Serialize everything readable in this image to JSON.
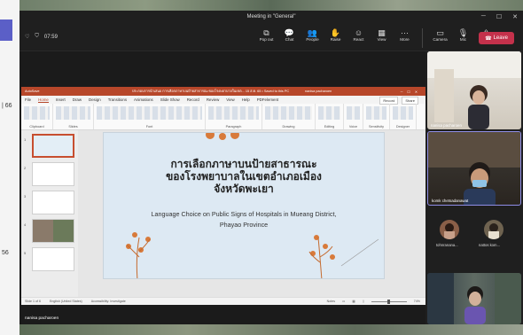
{
  "left_strip": {
    "num1": "| 66",
    "num2": "56"
  },
  "window": {
    "title": "Meeting in \"General\""
  },
  "meeting": {
    "timer": "07:59"
  },
  "toolbar": {
    "buttons": [
      {
        "icon": "pop-out-icon",
        "glyph": "⧉",
        "label": "Pop out"
      },
      {
        "icon": "chat-icon",
        "glyph": "💬",
        "label": "Chat"
      },
      {
        "icon": "people-icon",
        "glyph": "👥",
        "label": "People"
      },
      {
        "icon": "raise-hand-icon",
        "glyph": "✋",
        "label": "Raise"
      },
      {
        "icon": "react-icon",
        "glyph": "☺",
        "label": "React"
      },
      {
        "icon": "view-icon",
        "glyph": "▦",
        "label": "View"
      },
      {
        "icon": "more-icon",
        "glyph": "···",
        "label": "More"
      }
    ],
    "device_buttons": [
      {
        "icon": "camera-icon",
        "glyph": "▭",
        "label": "Camera"
      },
      {
        "icon": "mic-icon",
        "glyph": "🎙",
        "label": "Mic"
      },
      {
        "icon": "share-icon",
        "glyph": "⇪",
        "label": "Share"
      }
    ],
    "leave_label": "Leave"
  },
  "ppt": {
    "autosave": "AutoSave",
    "doc_title": "ประกอบการนำเสนอ การเลือกภาษาบนป้ายสาธารณะของโรงพยาบาลในเขต... 15 ส.ค. 65 • Saved to this PC",
    "user": "nanisa pacharoen",
    "menu": [
      "File",
      "Home",
      "Insert",
      "Draw",
      "Design",
      "Transitions",
      "Animations",
      "Slide Show",
      "Record",
      "Review",
      "View",
      "Help",
      "PDFelement"
    ],
    "record_label": "Record",
    "share_label": "Share",
    "ribbon_groups": [
      "Clipboard",
      "Slides",
      "Font",
      "Paragraph",
      "Drawing",
      "Editing",
      "Voice",
      "Sensitivity",
      "Designer"
    ],
    "slide_numbers": [
      "1",
      "2",
      "3",
      "4",
      "5"
    ],
    "slide": {
      "thai_title_line1": "การเลือกภาษาบนป้ายสาธารณะ",
      "thai_title_line2": "ของโรงพยาบาลในเขตอำเภอเมือง",
      "thai_title_line3": "จังหวัดพะเยา",
      "english_line1": "Language Choice on Public Signs of Hospitals in Mueang District,",
      "english_line2": "Phayao Province"
    },
    "status": {
      "slide_of": "Slide 1 of 6",
      "language": "English (United States)",
      "accessibility": "Accessibility: Investigate",
      "notes": "Notes",
      "zoom": "74%"
    }
  },
  "presenter_name": "nanisa pacharoen",
  "participants": [
    {
      "name": "nanisa pacharoen"
    },
    {
      "name": "komk chetsadanawat"
    },
    {
      "name": "tohnranana..."
    },
    {
      "name": "nattos kom..."
    }
  ]
}
